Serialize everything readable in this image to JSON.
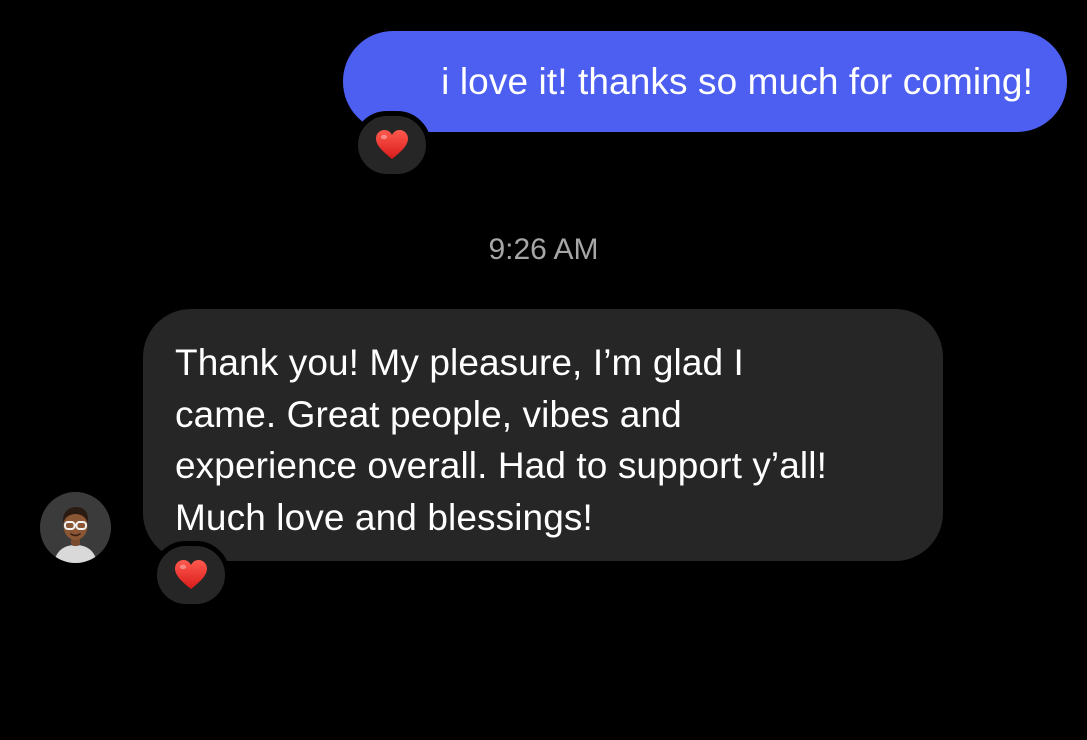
{
  "thread": {
    "outgoing": {
      "text": "i love it! thanks so much for coming!",
      "reaction": "heart-icon",
      "bubble_color": "#4c5ff0"
    },
    "timestamp": "9:26 AM",
    "incoming": {
      "lines": [
        "Thank you! My pleasure, I’m glad I",
        "came. Great people, vibes and",
        "experience overall. Had to support y’all!",
        "Much love and blessings!"
      ],
      "reaction": "heart-icon",
      "bubble_color": "#262626",
      "sender_avatar": "memoji-avatar"
    }
  }
}
